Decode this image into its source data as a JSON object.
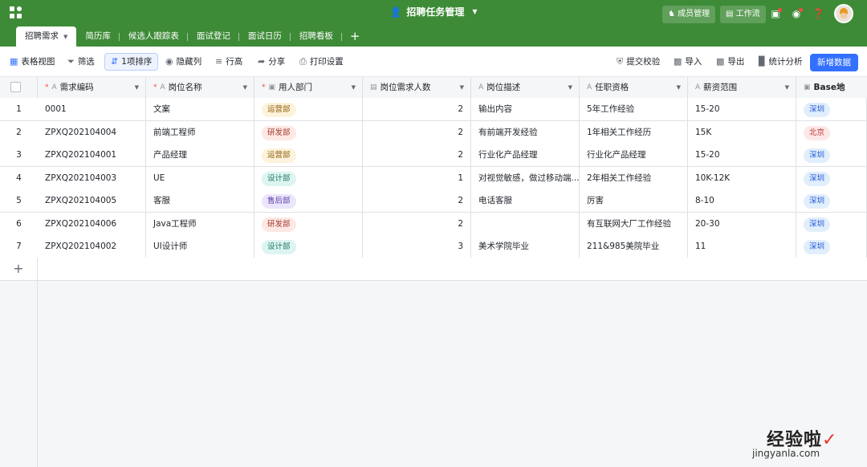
{
  "header": {
    "title": "招聘任务管理",
    "members_btn": "成员管理",
    "workflow_btn": "工作流",
    "colors": {
      "bg": "#3d8b37",
      "primary": "#3370ff"
    }
  },
  "tabs": [
    {
      "label": "招聘需求",
      "active": true
    },
    {
      "label": "简历库"
    },
    {
      "label": "候选人跟踪表"
    },
    {
      "label": "面试登记"
    },
    {
      "label": "面试日历"
    },
    {
      "label": "招聘看板"
    }
  ],
  "toolbar": {
    "view": "表格视图",
    "filter": "筛选",
    "sort": "1项排序",
    "hide": "隐藏列",
    "row_height": "行高",
    "share": "分享",
    "print": "打印设置",
    "verify": "提交校验",
    "import": "导入",
    "export": "导出",
    "stats": "统计分析",
    "new_record": "新增数据"
  },
  "columns": [
    "需求编码",
    "岗位名称",
    "用人部门",
    "岗位需求人数",
    "岗位描述",
    "任职资格",
    "薪资范围",
    "Base地"
  ],
  "rows": [
    {
      "n": "1",
      "code": "0001",
      "name": "文案",
      "dept": "运营部",
      "count": "2",
      "desc": "输出内容",
      "qual": "5年工作经验",
      "salary": "15-20",
      "base": "深圳"
    },
    {
      "n": "2",
      "code": "ZPXQ202104004",
      "name": "前端工程师",
      "dept": "研发部",
      "count": "2",
      "desc": "有前端开发经验",
      "qual": "1年相关工作经历",
      "salary": "15K",
      "base": "北京"
    },
    {
      "n": "3",
      "code": "ZPXQ202104001",
      "name": "产品经理",
      "dept": "运营部",
      "count": "2",
      "desc": "行业化产品经理",
      "qual": "行业化产品经理",
      "salary": "15-20",
      "base": "深圳"
    },
    {
      "n": "4",
      "code": "ZPXQ202104003",
      "name": "UE",
      "dept": "设计部",
      "count": "1",
      "desc": "对视觉敏感，做过移动端...",
      "qual": "2年相关工作经验",
      "salary": "10K-12K",
      "base": "深圳"
    },
    {
      "n": "5",
      "code": "ZPXQ202104005",
      "name": "客服",
      "dept": "售后部",
      "count": "2",
      "desc": "电话客服",
      "qual": "厉害",
      "salary": "8-10",
      "base": "深圳"
    },
    {
      "n": "6",
      "code": "ZPXQ202104006",
      "name": "Java工程师",
      "dept": "研发部",
      "count": "2",
      "desc": "",
      "qual": "有互联网大厂工作经验",
      "salary": "20-30",
      "base": "深圳"
    },
    {
      "n": "7",
      "code": "ZPXQ202104002",
      "name": "UI设计师",
      "dept": "设计部",
      "count": "3",
      "desc": "美术学院毕业",
      "qual": "211&985美院毕业",
      "salary": "11",
      "base": "深圳"
    }
  ],
  "tag_colors": {
    "运营部": {
      "bg": "#fdf3dc",
      "fg": "#8f5d0a"
    },
    "研发部": {
      "bg": "#fde8e4",
      "fg": "#a4392a"
    },
    "设计部": {
      "bg": "#ddf5f1",
      "fg": "#1e7566"
    },
    "售后部": {
      "bg": "#ebe6fb",
      "fg": "#5b3ea8"
    },
    "深圳": {
      "bg": "#e1eefc",
      "fg": "#245bdb"
    },
    "北京": {
      "bg": "#fde8e8",
      "fg": "#c23a3a"
    }
  },
  "watermark": {
    "text": "经验啦",
    "url": "jingyanla.com"
  }
}
